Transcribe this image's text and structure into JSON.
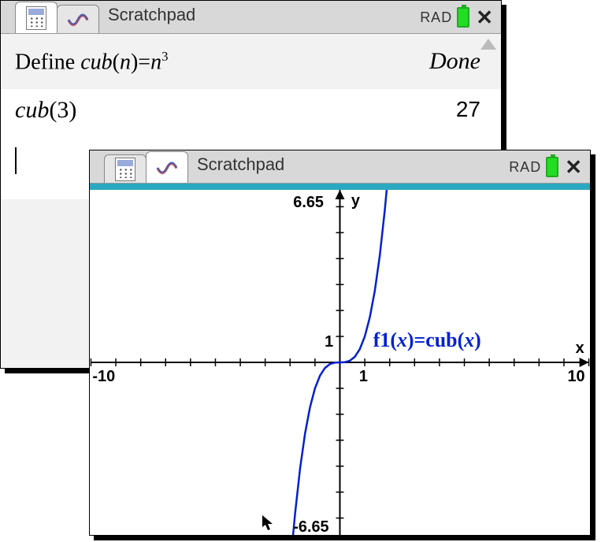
{
  "win1": {
    "title": "Scratchpad",
    "status_mode": "RAD",
    "line1_left_prefix": "Define ",
    "line1_left_func": "cub",
    "line1_left_arg": "n",
    "line1_left_eq": "=",
    "line1_left_base": "n",
    "line1_left_exp": "3",
    "line1_right": "Done",
    "line2_left_func": "cub",
    "line2_left_arg": "3",
    "line2_right": "27"
  },
  "win2": {
    "title": "Scratchpad",
    "status_mode": "RAD",
    "y_axis_label": "y",
    "x_axis_label": "x",
    "y_max": "6.65",
    "y_min": "-6.65",
    "y_tick": "1",
    "x_min": "-10",
    "x_max": "10",
    "x_tick": "1",
    "eqn_prefix": "f1",
    "eqn_arg1": "x",
    "eqn_mid": "=cub",
    "eqn_arg2": "x"
  },
  "chart_data": {
    "type": "line",
    "title": "",
    "xlabel": "x",
    "ylabel": "y",
    "xlim": [
      -10,
      10
    ],
    "ylim": [
      -6.65,
      6.65
    ],
    "series": [
      {
        "name": "f1(x)=cub(x)",
        "x": [
          -1.88,
          -1.8,
          -1.6,
          -1.4,
          -1.2,
          -1.0,
          -0.8,
          -0.6,
          -0.4,
          -0.2,
          0,
          0.2,
          0.4,
          0.6,
          0.8,
          1.0,
          1.2,
          1.4,
          1.6,
          1.8,
          1.88
        ],
        "values": [
          -6.65,
          -5.832,
          -4.096,
          -2.744,
          -1.728,
          -1.0,
          -0.512,
          -0.216,
          -0.064,
          -0.008,
          0,
          0.008,
          0.064,
          0.216,
          0.512,
          1.0,
          1.728,
          2.744,
          4.096,
          5.832,
          6.65
        ]
      }
    ],
    "x_ticks_labeled": [
      -10,
      1,
      10
    ],
    "y_ticks_labeled": [
      -6.65,
      1,
      6.65
    ]
  }
}
